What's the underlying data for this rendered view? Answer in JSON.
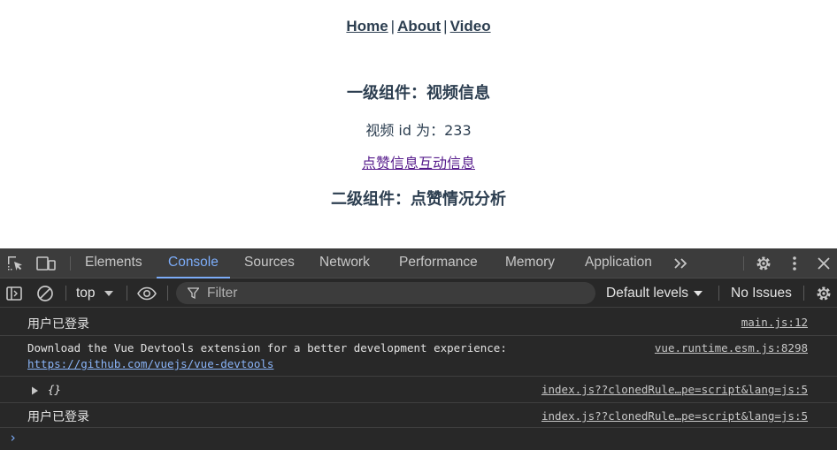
{
  "page": {
    "nav": {
      "home": "Home",
      "separator": "|",
      "about": "About",
      "video": "Video"
    },
    "level1_heading": "一级组件：视频信息",
    "video_id_text": "视频 id 为：233",
    "like_link": "点赞信息互动信息",
    "level2_heading": "二级组件：点赞情况分析"
  },
  "devtools": {
    "tabs": [
      "Elements",
      "Console",
      "Sources",
      "Network",
      "Performance",
      "Memory",
      "Application"
    ],
    "active_tab": "Console",
    "more_tabs_icon": "chevron-double-right-icon",
    "context": "top",
    "filter_placeholder": "Filter",
    "levels": "Default levels",
    "issues": "No Issues",
    "console": [
      {
        "message": "用户已登录",
        "source": "main.js:12"
      },
      {
        "message": "Download the Vue Devtools extension for a better development experience:",
        "link": "https://github.com/vuejs/vue-devtools",
        "source": "vue.runtime.esm.js:8298"
      },
      {
        "message": "{}",
        "source": "index.js??clonedRule…pe=script&lang=js:5"
      },
      {
        "message": "用户已登录",
        "source": "index.js??clonedRule…pe=script&lang=js:5"
      }
    ],
    "prompt": "›"
  },
  "colors": {
    "accent": "#7cacf8",
    "devtools_bg": "#282828",
    "tabbar_bg": "#3c3c3c",
    "page_text": "#2c3e50",
    "visited_link": "#551a8b"
  }
}
